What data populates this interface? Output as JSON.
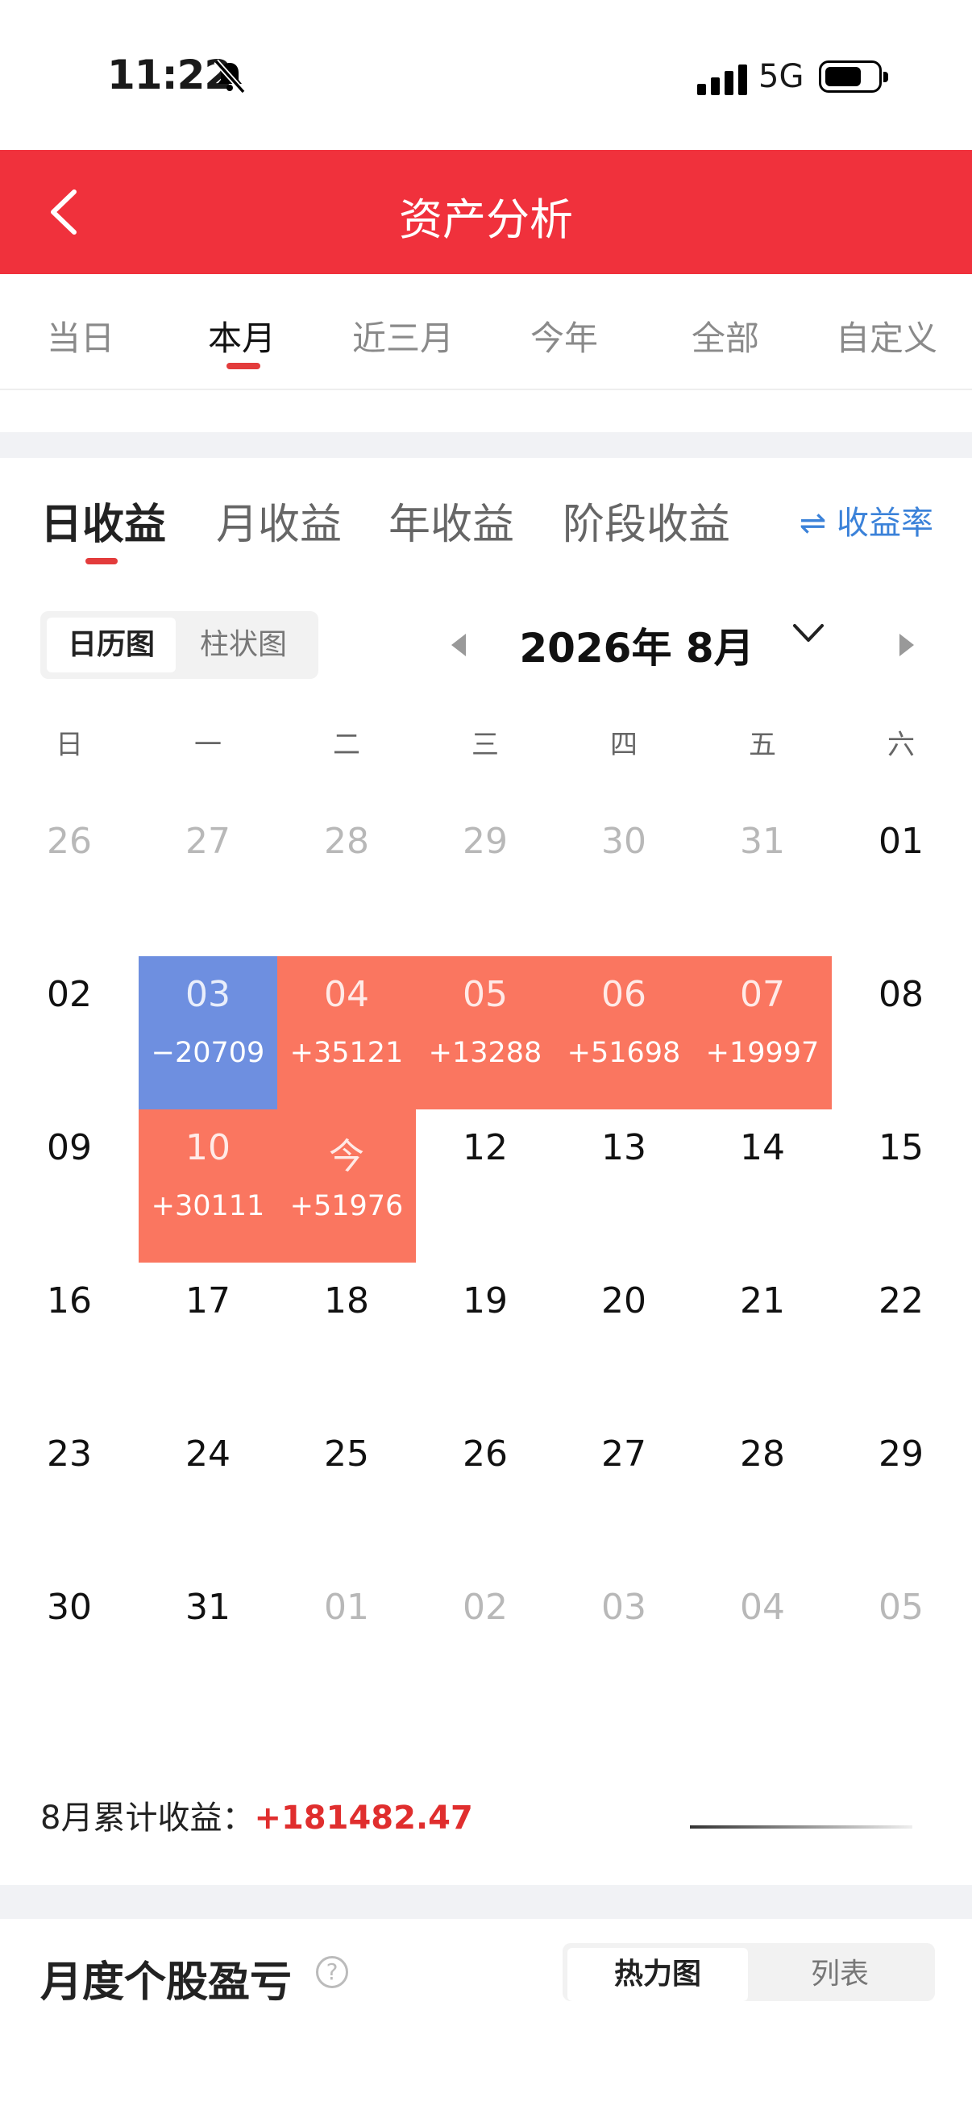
{
  "status": {
    "time": "11:22",
    "network": "5G"
  },
  "header": {
    "title": "资产分析"
  },
  "range_tabs": [
    "当日",
    "本月",
    "近三月",
    "今年",
    "全部",
    "自定义"
  ],
  "profit_tabs": [
    "日收益",
    "月收益",
    "年收益",
    "阶段收益"
  ],
  "rate_link": "⇌ 收益率",
  "view_toggle": [
    "日历图",
    "柱状图"
  ],
  "month_label": "2026年 8月",
  "weekdays": [
    "日",
    "一",
    "二",
    "三",
    "四",
    "五",
    "六"
  ],
  "calendar": [
    {
      "d": "26",
      "other": true
    },
    {
      "d": "27",
      "other": true
    },
    {
      "d": "28",
      "other": true
    },
    {
      "d": "29",
      "other": true
    },
    {
      "d": "30",
      "other": true
    },
    {
      "d": "31",
      "other": true
    },
    {
      "d": "01"
    },
    {
      "d": "02"
    },
    {
      "d": "03",
      "v": "−20709",
      "type": "loss"
    },
    {
      "d": "04",
      "v": "+35121",
      "type": "gain"
    },
    {
      "d": "05",
      "v": "+13288",
      "type": "gain"
    },
    {
      "d": "06",
      "v": "+51698",
      "type": "gain"
    },
    {
      "d": "07",
      "v": "+19997",
      "type": "gain"
    },
    {
      "d": "08"
    },
    {
      "d": "09"
    },
    {
      "d": "10",
      "v": "+30111",
      "type": "gain"
    },
    {
      "d": "今",
      "v": "+51976",
      "type": "gain"
    },
    {
      "d": "12"
    },
    {
      "d": "13"
    },
    {
      "d": "14"
    },
    {
      "d": "15"
    },
    {
      "d": "16"
    },
    {
      "d": "17"
    },
    {
      "d": "18"
    },
    {
      "d": "19"
    },
    {
      "d": "20"
    },
    {
      "d": "21"
    },
    {
      "d": "22"
    },
    {
      "d": "23"
    },
    {
      "d": "24"
    },
    {
      "d": "25"
    },
    {
      "d": "26"
    },
    {
      "d": "27"
    },
    {
      "d": "28"
    },
    {
      "d": "29"
    },
    {
      "d": "30"
    },
    {
      "d": "31"
    },
    {
      "d": "01",
      "other": true
    },
    {
      "d": "02",
      "other": true
    },
    {
      "d": "03",
      "other": true
    },
    {
      "d": "04",
      "other": true
    },
    {
      "d": "05",
      "other": true
    }
  ],
  "summary": {
    "label": "8月累计收益：",
    "value": "+181482.47"
  },
  "section": {
    "title": "月度个股盈亏",
    "help": "?"
  },
  "section_toggle": [
    "热力图",
    "列表"
  ]
}
